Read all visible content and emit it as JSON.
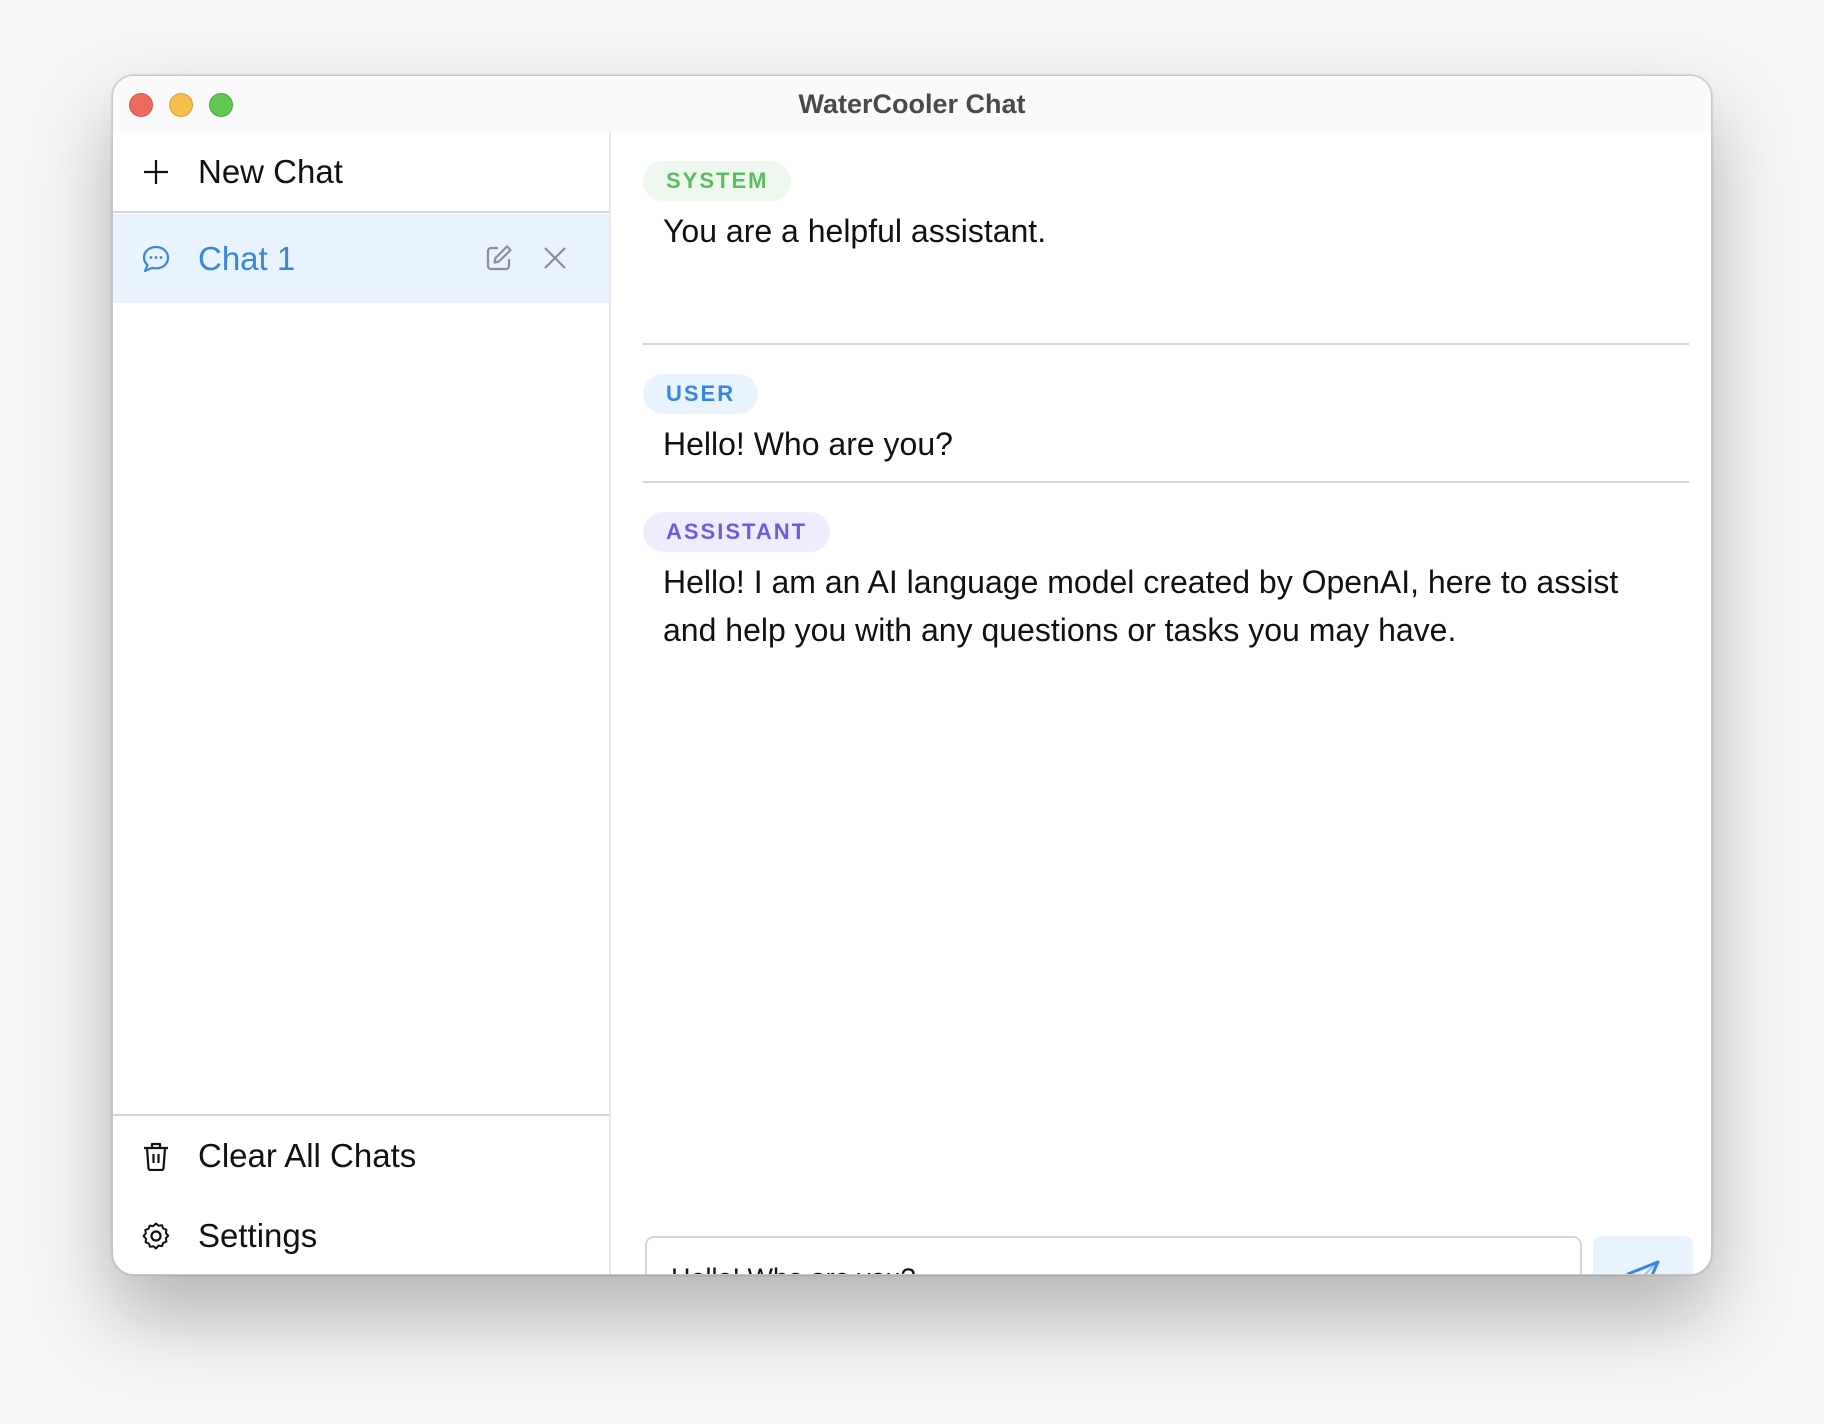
{
  "window": {
    "title": "WaterCooler Chat",
    "controls": [
      "close",
      "minimize",
      "zoom"
    ]
  },
  "sidebar": {
    "new_chat": {
      "label": "New Chat",
      "icon": "plus-icon"
    },
    "chats": [
      {
        "label": "Chat 1",
        "icon": "chat-bubble-icon",
        "active": true,
        "actions": [
          "edit-icon",
          "close-icon"
        ]
      }
    ],
    "footer": [
      {
        "label": "Clear All Chats",
        "icon": "trash-icon"
      },
      {
        "label": "Settings",
        "icon": "gear-icon"
      }
    ]
  },
  "messages": [
    {
      "role": "SYSTEM",
      "text": "You are a helpful assistant."
    },
    {
      "role": "USER",
      "text": "Hello! Who are you?"
    },
    {
      "role": "ASSISTANT",
      "text": "Hello! I am an AI language model created by OpenAI, here to assist and help you with any questions or tasks you may have."
    }
  ],
  "composer": {
    "value": "Hello! Who are you?",
    "send_icon": "send-icon"
  },
  "colors": {
    "accent": "#3a86dc",
    "active_row_bg": "#e8f3fd",
    "system_pill_text": "#5cbc63",
    "system_pill_bg": "#eef8ee",
    "user_pill_text": "#3a86dc",
    "user_pill_bg": "#e8f3fd",
    "assistant_pill_text": "#6c5ce0",
    "assistant_pill_bg": "#efedfd"
  }
}
